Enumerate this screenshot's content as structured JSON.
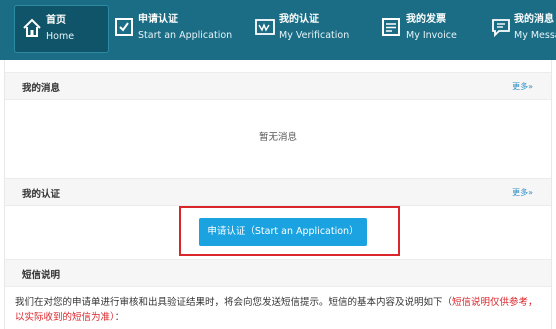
{
  "nav": {
    "items": [
      {
        "main": "首页",
        "sub": "Home",
        "icon": "home-icon"
      },
      {
        "main": "申请认证",
        "sub": "Start an Application",
        "icon": "checkbox-icon"
      },
      {
        "main": "我的认证",
        "sub": "My Verification",
        "icon": "certificate-icon"
      },
      {
        "main": "我的发票",
        "sub": "My Invoice",
        "icon": "invoice-icon"
      },
      {
        "main": "我的消息",
        "sub": "My Messa",
        "icon": "message-icon"
      }
    ]
  },
  "messages": {
    "title": "我的消息",
    "more": "更多»",
    "empty": "暂无消息"
  },
  "verification": {
    "title": "我的认证",
    "more": "更多»",
    "button": "申请认证（Start an Application）"
  },
  "sms": {
    "title": "短信说明",
    "body": "我们在对您的申请单进行审核和出具验证结果时，将会向您发送短信提示。短信的基本内容及说明如下（",
    "note": "短信说明仅供参考，以实际收到的短信为准）",
    "tail": "："
  },
  "colors": {
    "nav_bg": "#1a6d85",
    "button": "#1aa3e0",
    "highlight": "#d9262b",
    "link": "#2b8cc4"
  }
}
